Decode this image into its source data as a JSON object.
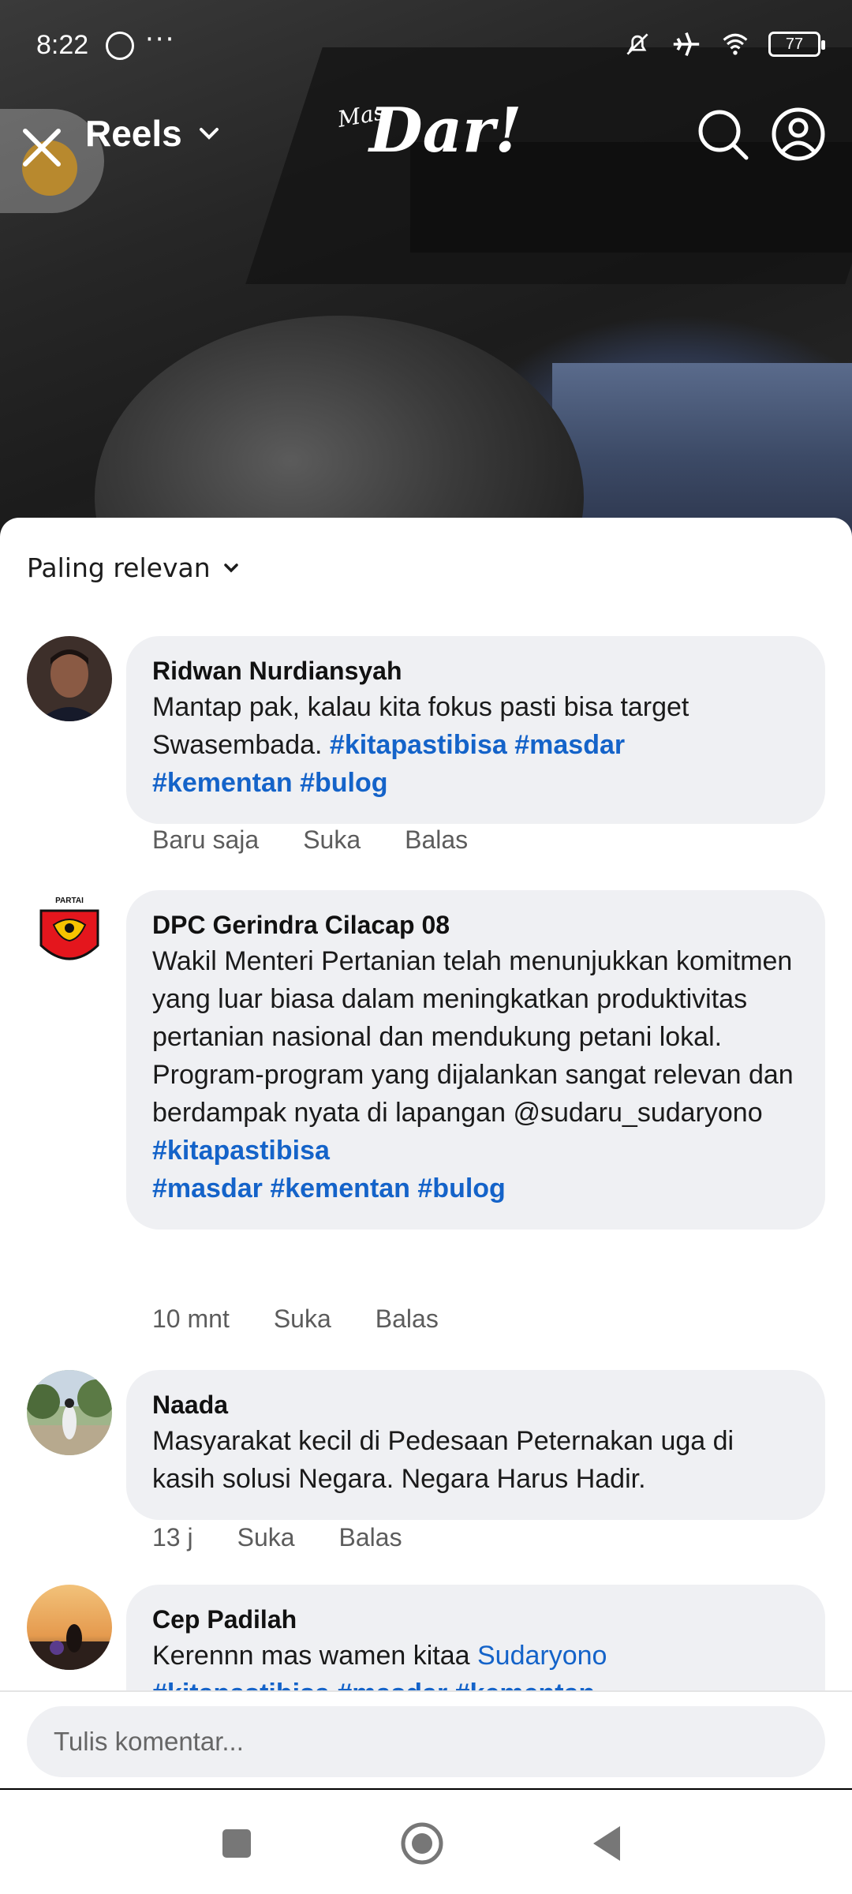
{
  "status_bar": {
    "time": "8:22",
    "battery": "77",
    "icons": [
      "whatsapp-icon",
      "more-dots-icon",
      "mute-bell-icon",
      "airplane-icon",
      "wifi-icon",
      "battery-icon"
    ]
  },
  "header": {
    "title": "Reels",
    "logo_small": "Mas",
    "logo_big": "Dar!",
    "icons": [
      "close-icon",
      "chevron-down-icon",
      "search-icon",
      "profile-icon"
    ]
  },
  "comments_panel": {
    "sort_label": "Paling relevan",
    "comments": [
      {
        "name": "Ridwan Nurdiansyah",
        "text_before": "Mantap pak, kalau kita fokus pasti bisa target Swasembada. ",
        "tags_inline": "#kitapastibisa #masdar",
        "tags_line": "#kementan #bulog",
        "time": "Baru saja",
        "like": "Suka",
        "reply": "Balas"
      },
      {
        "name": "DPC Gerindra Cilacap 08",
        "text": "Wakil Menteri Pertanian telah menunjukkan komitmen yang luar biasa dalam meningkatkan produktivitas pertanian nasional dan mendukung petani lokal. Program-program yang dijalankan sangat relevan dan berdampak nyata di lapangan @sudaru_sudaryono",
        "tags_line1": "#kitapastibisa",
        "tags_line2": "#masdar #kementan #bulog",
        "avatar_label": "PARTAI",
        "time": "10 mnt",
        "like": "Suka",
        "reply": "Balas"
      },
      {
        "name": "Naada",
        "text": "Masyarakat kecil di Pedesaan Peternakan uga di kasih solusi Negara. Negara Harus Hadir.",
        "time": "13 j",
        "like": "Suka",
        "reply": "Balas"
      },
      {
        "name": "Cep Padilah",
        "text_before": "Kerennn mas wamen kitaa ",
        "mention": "Sudaryono",
        "tags_line": "#kitapastibisa #masdar #kementan"
      }
    ]
  },
  "composer": {
    "placeholder": "Tulis komentar..."
  },
  "nav_bar": {
    "icons": [
      "recents-square-icon",
      "home-circle-icon",
      "back-triangle-icon"
    ]
  }
}
